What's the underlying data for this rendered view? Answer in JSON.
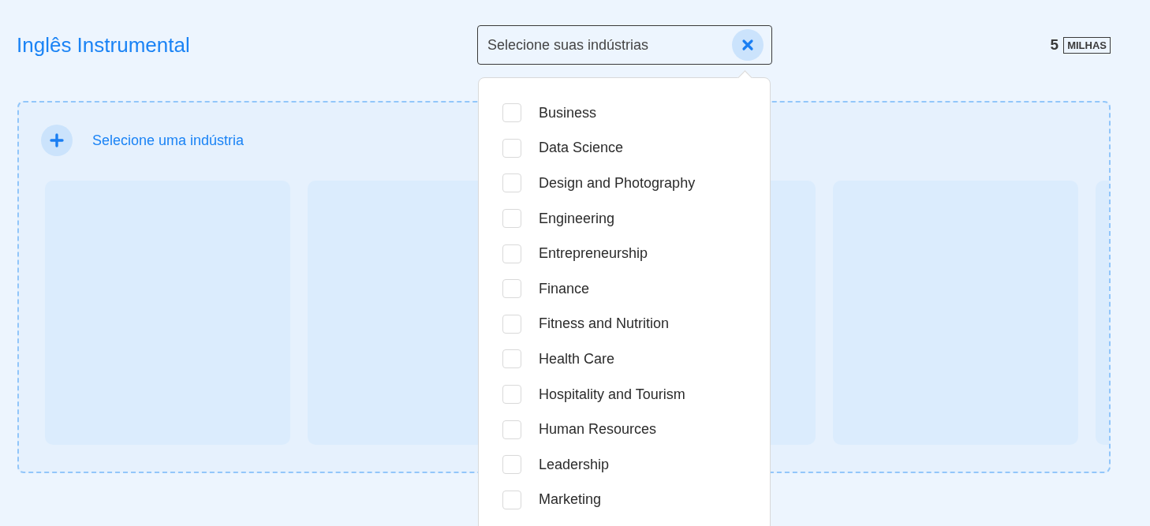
{
  "header": {
    "title": "Inglês Instrumental",
    "industry_field": {
      "placeholder": "Selecione suas indústrias"
    },
    "distance": {
      "value": "5",
      "unit": "MILHAS"
    }
  },
  "dropdown": {
    "options": [
      {
        "label": "Business",
        "checked": false
      },
      {
        "label": "Data Science",
        "checked": false
      },
      {
        "label": "Design and Photography",
        "checked": false
      },
      {
        "label": "Engineering",
        "checked": false
      },
      {
        "label": "Entrepreneurship",
        "checked": false
      },
      {
        "label": "Finance",
        "checked": false
      },
      {
        "label": "Fitness and Nutrition",
        "checked": false
      },
      {
        "label": "Health Care",
        "checked": false
      },
      {
        "label": "Hospitality and Tourism",
        "checked": false
      },
      {
        "label": "Human Resources",
        "checked": false
      },
      {
        "label": "Leadership",
        "checked": false
      },
      {
        "label": "Marketing",
        "checked": false
      }
    ]
  },
  "industry_panel": {
    "add_label": "Selecione uma indústria",
    "cards": [
      {
        "kind": "skeleton"
      },
      {
        "kind": "skeleton"
      },
      {
        "kind": "skeleton"
      },
      {
        "kind": "skeleton"
      },
      {
        "kind": "skeleton"
      }
    ]
  }
}
